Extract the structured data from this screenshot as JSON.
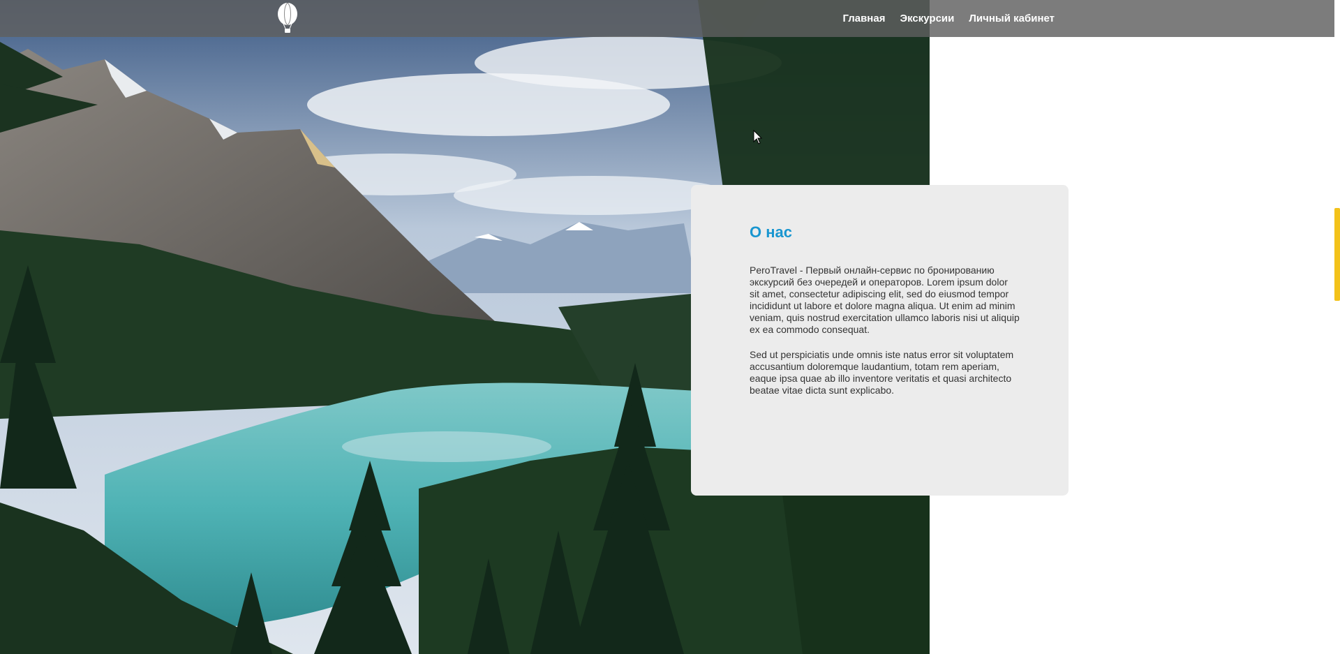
{
  "header": {
    "logo_icon": "hot-air-balloon-icon",
    "nav": {
      "home": "Главная",
      "tours": "Экскурсии",
      "account": "Личный кабинет"
    }
  },
  "about": {
    "title": "О нас",
    "paragraph1": "PeroTravel - Первый онлайн-сервис по бронированию экскурсий без очередей и операторов. Lorem ipsum dolor sit amet, consectetur adipiscing elit, sed do eiusmod tempor incididunt ut labore et dolore magna aliqua. Ut enim ad minim veniam, quis nostrud exercitation ullamco laboris nisi ut aliquip ex ea commodo consequat.",
    "paragraph2": "Sed ut perspiciatis unde omnis iste natus error sit voluptatem accusantium doloremque laudantium, totam rem aperiam, eaque ipsa quae ab illo inventore veritatis et quasi architecto beatae vitae dicta sunt explicabo."
  },
  "colors": {
    "accent": "#1996d0",
    "scrollbar_thumb": "#f3c21a",
    "navbar": "#5f5f5f",
    "card_bg": "#ececec"
  }
}
